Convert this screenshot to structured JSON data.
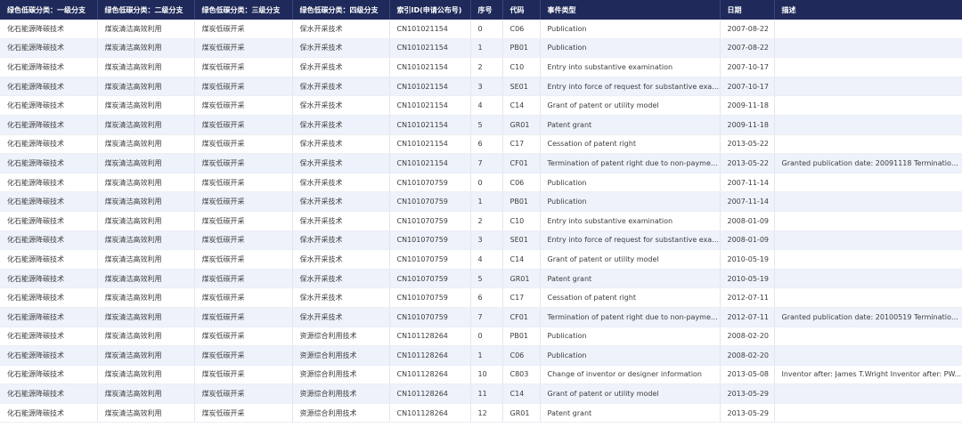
{
  "colors": {
    "header_bg": "#1f2a5a",
    "header_text": "#ffffff",
    "row_alt": "#eef2fb",
    "row_base": "#ffffff"
  },
  "table": {
    "columns": [
      "绿色低碳分类：一级分支",
      "绿色低碳分类：二级分支",
      "绿色低碳分类：三级分支",
      "绿色低碳分类：四级分支",
      "索引ID(申请公布号)",
      "序号",
      "代码",
      "事件类型",
      "日期",
      "描述"
    ],
    "rows": [
      [
        "化石能源降碳技术",
        "煤炭清洁高效利用",
        "煤炭低碳开采",
        "保水开采技术",
        "CN101021154",
        "0",
        "C06",
        "Publication",
        "2007-08-22",
        ""
      ],
      [
        "化石能源降碳技术",
        "煤炭清洁高效利用",
        "煤炭低碳开采",
        "保水开采技术",
        "CN101021154",
        "1",
        "PB01",
        "Publication",
        "2007-08-22",
        ""
      ],
      [
        "化石能源降碳技术",
        "煤炭清洁高效利用",
        "煤炭低碳开采",
        "保水开采技术",
        "CN101021154",
        "2",
        "C10",
        "Entry into substantive examination",
        "2007-10-17",
        ""
      ],
      [
        "化石能源降碳技术",
        "煤炭清洁高效利用",
        "煤炭低碳开采",
        "保水开采技术",
        "CN101021154",
        "3",
        "SE01",
        "Entry into force of request for substantive examin...",
        "2007-10-17",
        ""
      ],
      [
        "化石能源降碳技术",
        "煤炭清洁高效利用",
        "煤炭低碳开采",
        "保水开采技术",
        "CN101021154",
        "4",
        "C14",
        "Grant of patent or utility model",
        "2009-11-18",
        ""
      ],
      [
        "化石能源降碳技术",
        "煤炭清洁高效利用",
        "煤炭低碳开采",
        "保水开采技术",
        "CN101021154",
        "5",
        "GR01",
        "Patent grant",
        "2009-11-18",
        ""
      ],
      [
        "化石能源降碳技术",
        "煤炭清洁高效利用",
        "煤炭低碳开采",
        "保水开采技术",
        "CN101021154",
        "6",
        "C17",
        "Cessation of patent right",
        "2013-05-22",
        ""
      ],
      [
        "化石能源降碳技术",
        "煤炭清洁高效利用",
        "煤炭低碳开采",
        "保水开采技术",
        "CN101021154",
        "7",
        "CF01",
        "Termination of patent right due to non-payment ...",
        "2013-05-22",
        "Granted publication date: 20091118 Termination ..."
      ],
      [
        "化石能源降碳技术",
        "煤炭清洁高效利用",
        "煤炭低碳开采",
        "保水开采技术",
        "CN101070759",
        "0",
        "C06",
        "Publication",
        "2007-11-14",
        ""
      ],
      [
        "化石能源降碳技术",
        "煤炭清洁高效利用",
        "煤炭低碳开采",
        "保水开采技术",
        "CN101070759",
        "1",
        "PB01",
        "Publication",
        "2007-11-14",
        ""
      ],
      [
        "化石能源降碳技术",
        "煤炭清洁高效利用",
        "煤炭低碳开采",
        "保水开采技术",
        "CN101070759",
        "2",
        "C10",
        "Entry into substantive examination",
        "2008-01-09",
        ""
      ],
      [
        "化石能源降碳技术",
        "煤炭清洁高效利用",
        "煤炭低碳开采",
        "保水开采技术",
        "CN101070759",
        "3",
        "SE01",
        "Entry into force of request for substantive examin...",
        "2008-01-09",
        ""
      ],
      [
        "化石能源降碳技术",
        "煤炭清洁高效利用",
        "煤炭低碳开采",
        "保水开采技术",
        "CN101070759",
        "4",
        "C14",
        "Grant of patent or utility model",
        "2010-05-19",
        ""
      ],
      [
        "化石能源降碳技术",
        "煤炭清洁高效利用",
        "煤炭低碳开采",
        "保水开采技术",
        "CN101070759",
        "5",
        "GR01",
        "Patent grant",
        "2010-05-19",
        ""
      ],
      [
        "化石能源降碳技术",
        "煤炭清洁高效利用",
        "煤炭低碳开采",
        "保水开采技术",
        "CN101070759",
        "6",
        "C17",
        "Cessation of patent right",
        "2012-07-11",
        ""
      ],
      [
        "化石能源降碳技术",
        "煤炭清洁高效利用",
        "煤炭低碳开采",
        "保水开采技术",
        "CN101070759",
        "7",
        "CF01",
        "Termination of patent right due to non-payment ...",
        "2012-07-11",
        "Granted publication date: 20100519 Termination ..."
      ],
      [
        "化石能源降碳技术",
        "煤炭清洁高效利用",
        "煤炭低碳开采",
        "资源综合利用技术",
        "CN101128264",
        "0",
        "PB01",
        "Publication",
        "2008-02-20",
        ""
      ],
      [
        "化石能源降碳技术",
        "煤炭清洁高效利用",
        "煤炭低碳开采",
        "资源综合利用技术",
        "CN101128264",
        "1",
        "C06",
        "Publication",
        "2008-02-20",
        ""
      ],
      [
        "化石能源降碳技术",
        "煤炭清洁高效利用",
        "煤炭低碳开采",
        "资源综合利用技术",
        "CN101128264",
        "10",
        "C803",
        "Change of inventor or designer information",
        "2013-05-08",
        "Inventor after: James T.Wright Inventor after: PW..."
      ],
      [
        "化石能源降碳技术",
        "煤炭清洁高效利用",
        "煤炭低碳开采",
        "资源综合利用技术",
        "CN101128264",
        "11",
        "C14",
        "Grant of patent or utility model",
        "2013-05-29",
        ""
      ],
      [
        "化石能源降碳技术",
        "煤炭清洁高效利用",
        "煤炭低碳开采",
        "资源综合利用技术",
        "CN101128264",
        "12",
        "GR01",
        "Patent grant",
        "2013-05-29",
        ""
      ]
    ]
  }
}
